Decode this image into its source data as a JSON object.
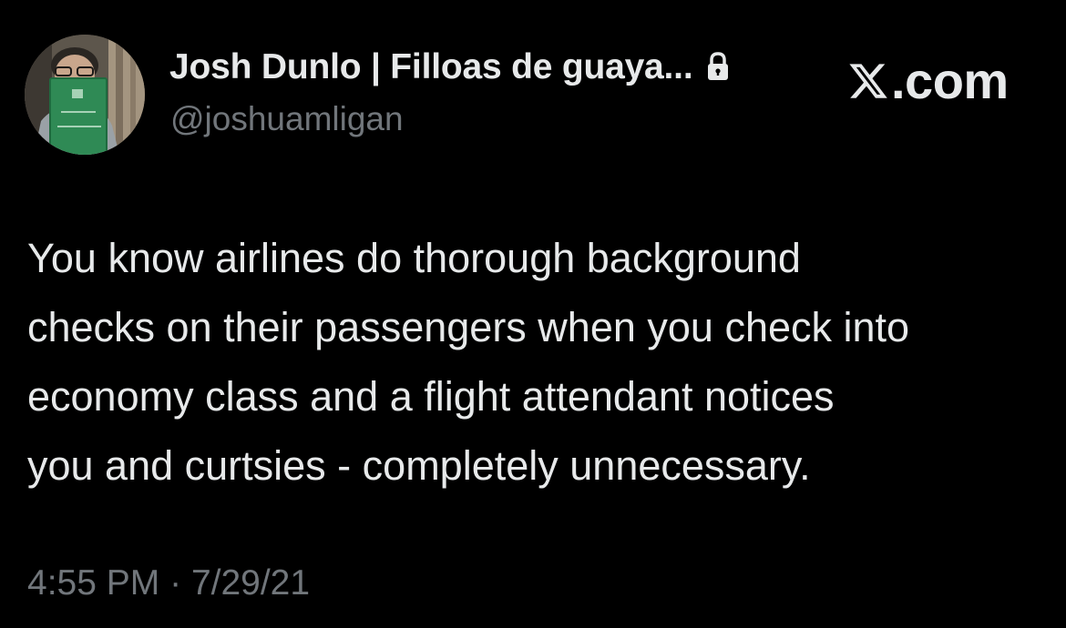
{
  "author": {
    "display_name": "Josh Dunlo | Filloas de guaya...",
    "handle": "@joshuamligan",
    "locked": true
  },
  "brand": {
    "icon": "x-logo-icon",
    "suffix": ".com"
  },
  "tweet": {
    "text": "You know airlines do thorough background\nchecks on their passengers when you check into\neconomy class and a flight attendant notices\nyou and curtsies - completely unnecessary.",
    "time": "4:55 PM",
    "separator": "·",
    "date": "7/29/21"
  },
  "colors": {
    "background": "#000000",
    "primary_text": "#e7e9ea",
    "secondary_text": "#71767b"
  }
}
